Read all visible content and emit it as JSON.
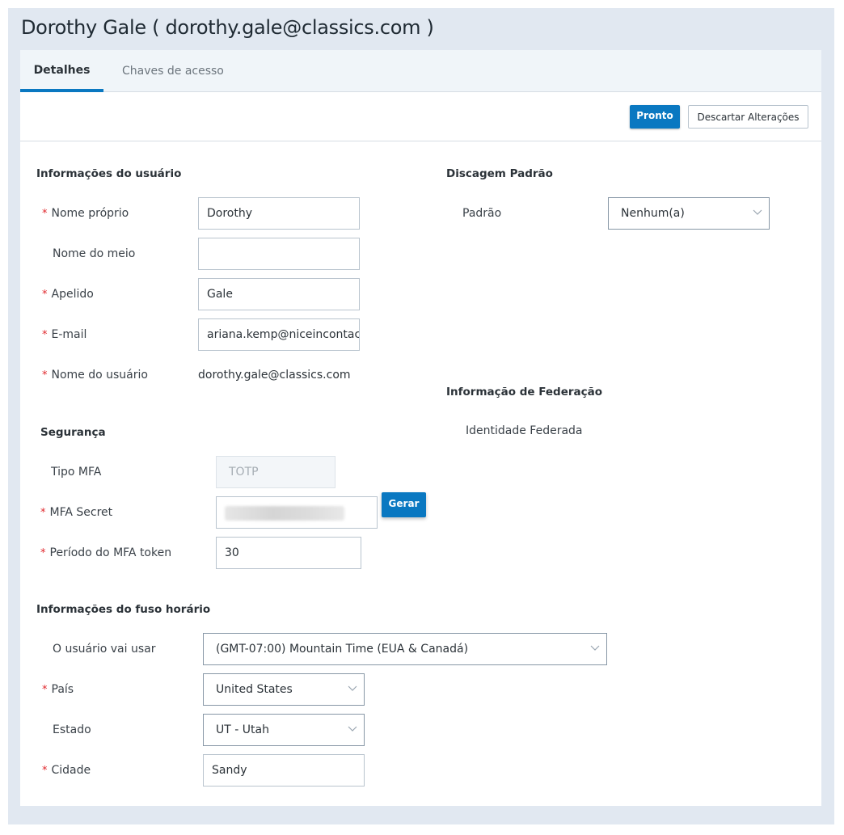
{
  "header": {
    "title": "Dorothy Gale ( dorothy.gale@classics.com )"
  },
  "tabs": [
    {
      "label": "Detalhes",
      "active": true
    },
    {
      "label": "Chaves de acesso",
      "active": false
    }
  ],
  "toolbar": {
    "done_label": "Pronto",
    "discard_label": "Descartar Alterações"
  },
  "user_info": {
    "title": "Informações do usuário",
    "first_name": {
      "label": "Nome próprio",
      "required": true,
      "value": "Dorothy"
    },
    "middle_name": {
      "label": "Nome do meio",
      "required": false,
      "value": ""
    },
    "last_name": {
      "label": "Apelido",
      "required": true,
      "value": "Gale"
    },
    "email": {
      "label": "E-mail",
      "required": true,
      "value": "ariana.kemp@niceincontact"
    },
    "username": {
      "label": "Nome do usuário",
      "required": true,
      "value": "dorothy.gale@classics.com"
    }
  },
  "default_dialing": {
    "title": "Discagem Padrão",
    "default": {
      "label": "Padrão",
      "value": "Nenhum(a)"
    }
  },
  "federation": {
    "title": "Informação de Federação",
    "federated_identity_label": "Identidade Federada"
  },
  "security": {
    "title": "Segurança",
    "mfa_type": {
      "label": "Tipo MFA",
      "value": "TOTP"
    },
    "mfa_secret": {
      "label": "MFA Secret",
      "required": true,
      "value": "(obscured)"
    },
    "generate_label": "Gerar",
    "mfa_token_period": {
      "label": "Período do MFA token",
      "required": true,
      "value": "30"
    }
  },
  "timezone": {
    "title": "Informações do fuso horário",
    "user_timezone": {
      "label": "O usuário vai usar",
      "value": "(GMT-07:00) Mountain Time (EUA & Canadá)"
    },
    "country": {
      "label": "País",
      "required": true,
      "value": "United States"
    },
    "state": {
      "label": "Estado",
      "required": false,
      "value": "UT - Utah"
    },
    "city": {
      "label": "Cidade",
      "required": true,
      "value": "Sandy"
    }
  },
  "required_marker": "*"
}
